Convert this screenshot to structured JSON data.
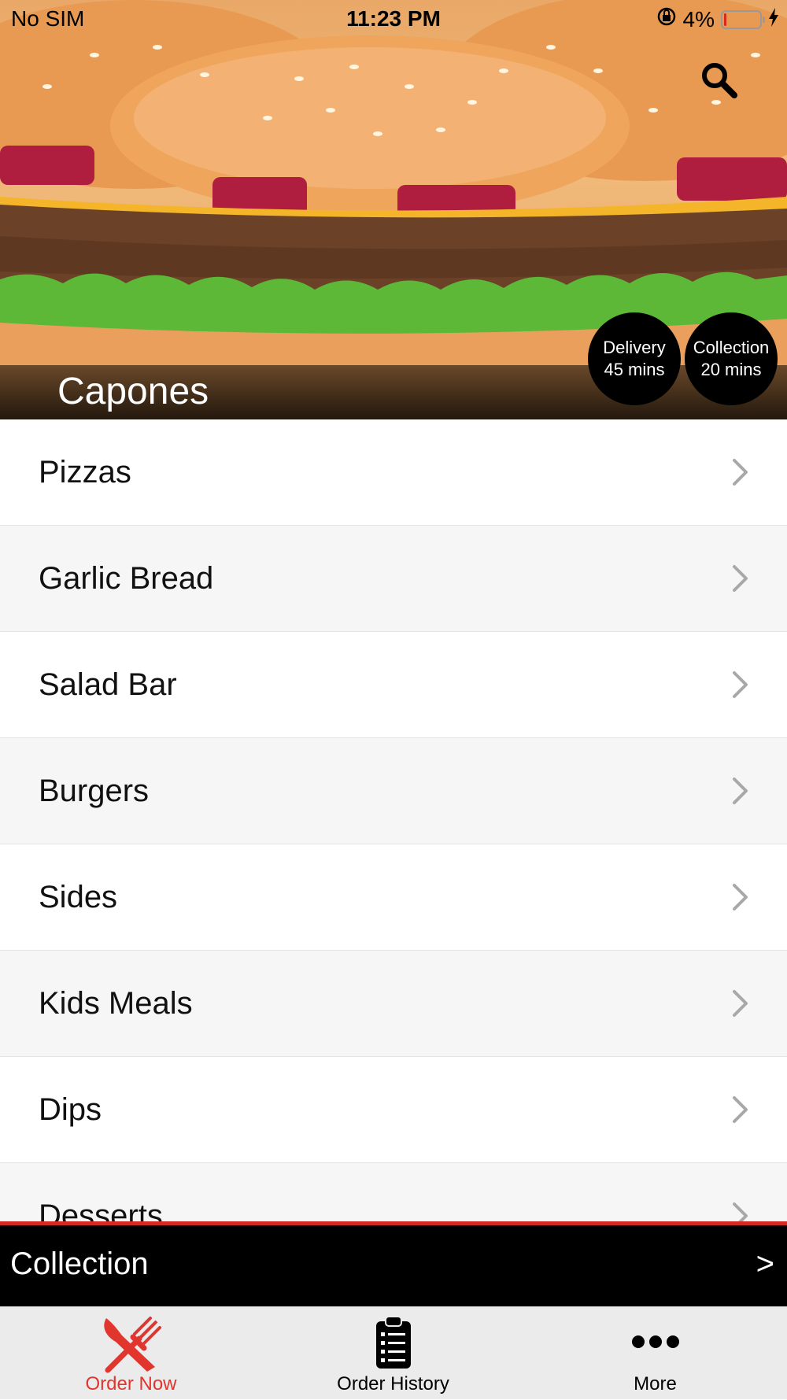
{
  "status_bar": {
    "carrier": "No SIM",
    "time": "11:23 PM",
    "battery": "4%"
  },
  "hero": {
    "restaurant_name": "Capones",
    "delivery": {
      "label": "Delivery",
      "time": "45 mins"
    },
    "collection": {
      "label": "Collection",
      "time": "20 mins"
    }
  },
  "menu": {
    "categories": [
      {
        "label": "Pizzas"
      },
      {
        "label": "Garlic Bread"
      },
      {
        "label": "Salad Bar"
      },
      {
        "label": "Burgers"
      },
      {
        "label": "Sides"
      },
      {
        "label": "Kids Meals"
      },
      {
        "label": "Dips"
      },
      {
        "label": "Desserts"
      }
    ]
  },
  "collection_bar": {
    "label": "Collection",
    "arrow": ">"
  },
  "tab_bar": {
    "tabs": [
      {
        "label": "Order Now",
        "icon": "fork-knife-icon",
        "active": true
      },
      {
        "label": "Order History",
        "icon": "clipboard-list-icon",
        "active": false
      },
      {
        "label": "More",
        "icon": "more-dots-icon",
        "active": false
      }
    ]
  },
  "colors": {
    "accent": "#e0362e",
    "collection_bar_border": "#d32a24",
    "badge_background": "#000000",
    "tab_bar_background": "#ebebeb"
  }
}
